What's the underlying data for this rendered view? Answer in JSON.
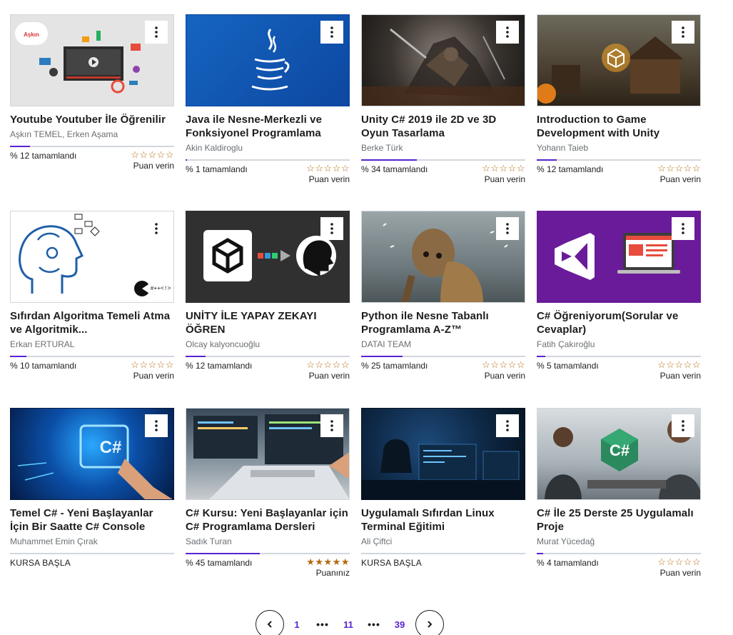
{
  "menu_icon": "kebab-menu-icon",
  "colors": {
    "accent": "#5624d0",
    "star": "#b4690e",
    "track": "#d1d7dc"
  },
  "courses": [
    {
      "title": "Youtube Youtuber İle Öğrenilir",
      "author": "Aşkın TEMEL, Erken Aşama",
      "progress_label": "% 12 tamamlandı",
      "progress": 12,
      "stars": "☆☆☆☆☆",
      "rating_label": "Puan verin",
      "thumb_logo": "Aşkın"
    },
    {
      "title": "Java ile Nesne-Merkezli ve Fonksiyonel Programlama",
      "author": "Akin Kaldiroglu",
      "progress_label": "% 1 tamamlandı",
      "progress": 1,
      "stars": "☆☆☆☆☆",
      "rating_label": "Puan verin"
    },
    {
      "title": "Unity C# 2019 ile 2D ve 3D Oyun Tasarlama",
      "author": "Berke Türk",
      "progress_label": "% 34 tamamlandı",
      "progress": 34,
      "stars": "☆☆☆☆☆",
      "rating_label": "Puan verin"
    },
    {
      "title": "Introduction to Game Development with Unity",
      "author": "Yohann Taieb",
      "progress_label": "% 12 tamamlandı",
      "progress": 12,
      "stars": "☆☆☆☆☆",
      "rating_label": "Puan verin"
    },
    {
      "title": "Sıfırdan Algoritma Temeli Atma ve Algoritmik...",
      "author": "Erkan ERTURAL",
      "progress_label": "% 10 tamamlandı",
      "progress": 10,
      "stars": "☆☆☆☆☆",
      "rating_label": "Puan verin",
      "thumb_text": "#++<!>"
    },
    {
      "title": "UNİTY İLE YAPAY ZEKAYI ÖĞREN",
      "author": "Olcay kalyoncuoğlu",
      "progress_label": "% 12 tamamlandı",
      "progress": 12,
      "stars": "☆☆☆☆☆",
      "rating_label": "Puan verin"
    },
    {
      "title": "Python ile Nesne Tabanlı Programlama A-Z™",
      "author": "DATAI TEAM",
      "progress_label": "% 25 tamamlandı",
      "progress": 25,
      "stars": "☆☆☆☆☆",
      "rating_label": "Puan verin"
    },
    {
      "title": "C# Öğreniyorum(Sorular ve Cevaplar)",
      "author": "Fatih Çakıroğlu",
      "progress_label": "% 5 tamamlandı",
      "progress": 5,
      "stars": "☆☆☆☆☆",
      "rating_label": "Puan verin"
    },
    {
      "title": "Temel C# - Yeni Başlayanlar İçin Bir Saatte C# Console",
      "author": "Muhammet Emin Çırak",
      "progress_label": "KURSA BAŞLA",
      "progress": 0,
      "thumb_text": "C#"
    },
    {
      "title": "C# Kursu: Yeni Başlayanlar için C# Programlama Dersleri",
      "author": "Sadık Turan",
      "progress_label": "% 45 tamamlandı",
      "progress": 45,
      "stars": "★★★★★",
      "rating_label": "Puanınız"
    },
    {
      "title": "Uygulamalı Sıfırdan Linux Terminal Eğitimi",
      "author": "Ali Çiftci",
      "progress_label": "KURSA BAŞLA",
      "progress": 0
    },
    {
      "title": "C# İle 25 Derste 25 Uygulamalı Proje",
      "author": "Murat Yücedağ",
      "progress_label": "% 4 tamamlandı",
      "progress": 4,
      "stars": "☆☆☆☆☆",
      "rating_label": "Puan verin",
      "thumb_text": "C#"
    }
  ],
  "pagination": {
    "prev_icon": "chevron-left-icon",
    "next_icon": "chevron-right-icon",
    "pages": [
      "1",
      "11",
      "39"
    ],
    "current": "11",
    "dots": "•••"
  }
}
